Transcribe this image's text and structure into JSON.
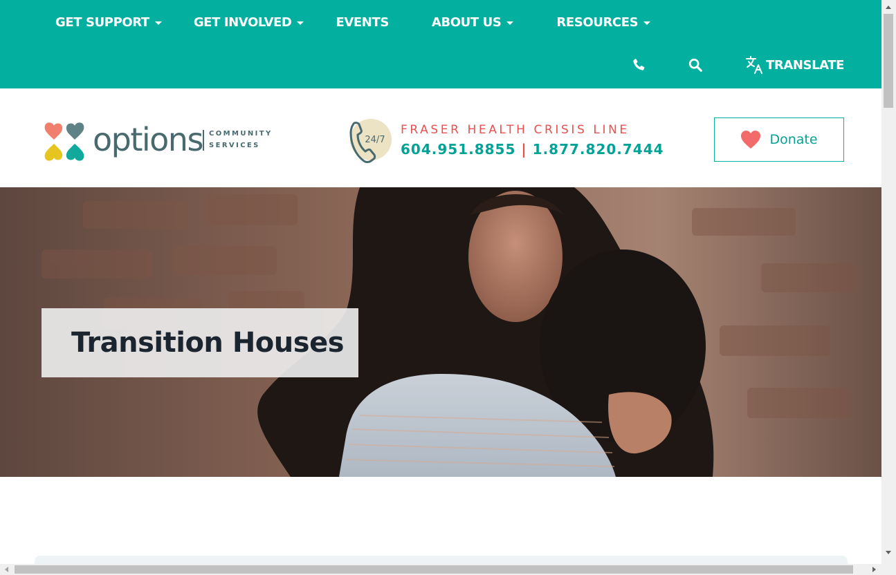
{
  "nav": {
    "items": [
      {
        "label": "GET SUPPORT",
        "has_dropdown": true
      },
      {
        "label": "GET INVOLVED",
        "has_dropdown": true
      },
      {
        "label": "EVENTS",
        "has_dropdown": false
      },
      {
        "label": "ABOUT US",
        "has_dropdown": true
      },
      {
        "label": "RESOURCES",
        "has_dropdown": true
      }
    ],
    "utility": {
      "phone_icon": "phone-icon",
      "search_icon": "search-icon",
      "translate_icon": "translate-icon",
      "translate_label": "TRANSLATE"
    }
  },
  "header": {
    "logo": {
      "wordmark": "options",
      "subline_1": "COMMUNITY",
      "subline_2": "SERVICES"
    },
    "crisis": {
      "badge": "24/7",
      "title": "FRASER HEALTH CRISIS LINE",
      "phone_1": "604.951.8855",
      "separator": "|",
      "phone_2": "1.877.820.7444"
    },
    "donate": {
      "label": "Donate",
      "icon": "heart-icon"
    }
  },
  "hero": {
    "title": "Transition Houses"
  },
  "colors": {
    "brand_teal": "#03b0a0",
    "accent_coral": "#e8504f",
    "logo_slate": "#486a6f",
    "title_dark": "#1b2530"
  }
}
